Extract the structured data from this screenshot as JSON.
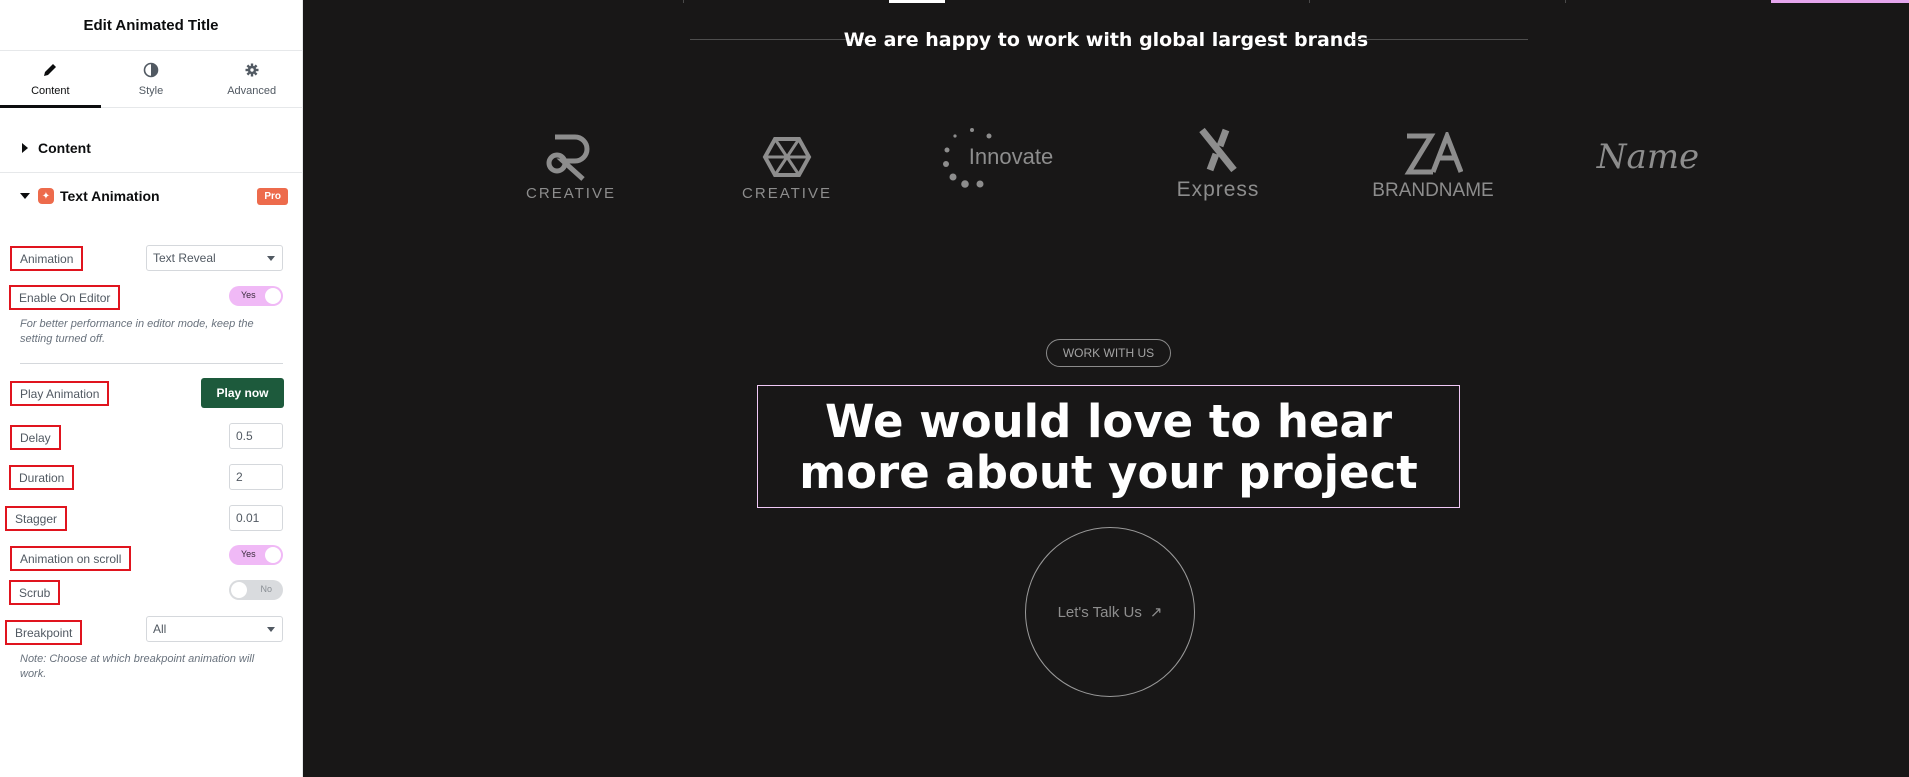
{
  "panel": {
    "title": "Edit Animated Title",
    "tabs": [
      {
        "label": "Content",
        "icon": "pencil-icon"
      },
      {
        "label": "Style",
        "icon": "half-circle-icon"
      },
      {
        "label": "Advanced",
        "icon": "gear-icon"
      }
    ],
    "sections": {
      "content": "Content",
      "text_animation": "Text Animation",
      "pro_badge": "Pro"
    },
    "controls": {
      "animation_label": "Animation",
      "animation_value": "Text Reveal",
      "enable_editor_label": "Enable On Editor",
      "enable_editor_value": "Yes",
      "editor_hint": "For better performance in editor mode, keep the setting turned off.",
      "play_animation_label": "Play Animation",
      "play_button": "Play now",
      "delay_label": "Delay",
      "delay_value": "0.5",
      "duration_label": "Duration",
      "duration_value": "2",
      "stagger_label": "Stagger",
      "stagger_value": "0.01",
      "scroll_label": "Animation on scroll",
      "scroll_value": "Yes",
      "scrub_label": "Scrub",
      "scrub_value": "No",
      "breakpoint_label": "Breakpoint",
      "breakpoint_value": "All",
      "breakpoint_hint": "Note: Choose at which breakpoint animation will work."
    }
  },
  "canvas": {
    "brands_title": "We are happy to work with global largest brands",
    "logos": [
      {
        "name": "creative-r-logo",
        "text": "CREATIVE"
      },
      {
        "name": "creative-diamond-logo",
        "text": "CREATIVE"
      },
      {
        "name": "innovate-logo",
        "text": "Innovate"
      },
      {
        "name": "express-logo",
        "text": "Express"
      },
      {
        "name": "brandname-logo",
        "text": "BRANDNAME"
      },
      {
        "name": "name-script-logo",
        "text": "Name"
      }
    ],
    "work_pill": "WORK WITH US",
    "headline": "We would love to hear more about your project",
    "cta": "Let's Talk Us",
    "cta_arrow": "↗"
  },
  "colors": {
    "canvas_bg": "#181717",
    "highlight_outline": "#e0141e",
    "toggle_on": "#f0b9f6",
    "play_button": "#1d5a3c",
    "pro_badge": "#ed6b4c"
  }
}
